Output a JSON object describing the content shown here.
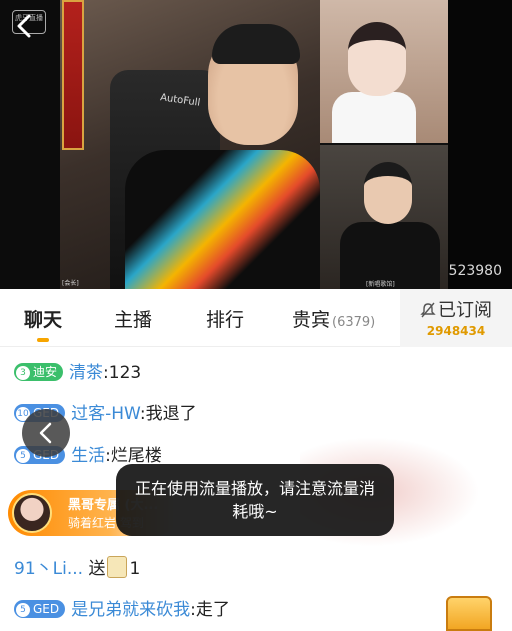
{
  "video": {
    "room_id": "523980",
    "watermark": "虎牙直播",
    "chair_logo": "AutoFull",
    "cam_labels": [
      "[会长]",
      "[新唱歌馆]"
    ]
  },
  "tabs": [
    {
      "label": "聊天",
      "active": true
    },
    {
      "label": "主播",
      "active": false
    },
    {
      "label": "排行",
      "active": false
    },
    {
      "label": "贵宾",
      "count": "(6379)",
      "active": false
    }
  ],
  "subscribe": {
    "label": "已订阅",
    "count": "2948434"
  },
  "chat": [
    {
      "level": "3",
      "badge": "迪安",
      "badge_color": "#3bbf6b",
      "user": "清茶",
      "sep": ":",
      "text": "123"
    },
    {
      "level": "10",
      "badge": "GED",
      "badge_color": "#4a90e2",
      "user": "过客-HW",
      "sep": ":",
      "text": "我退了"
    },
    {
      "level": "5",
      "badge": "GED",
      "badge_color": "#4a90e2",
      "user": "生活",
      "sep": ":",
      "text": "烂尾楼"
    },
    {
      "user": "91丶Li...",
      "text": "送",
      "gift_count": "1"
    },
    {
      "level": "5",
      "badge": "GED",
      "badge_color": "#4a90e2",
      "user": "是兄弟就来砍我",
      "sep": ":",
      "text": "走了"
    }
  ],
  "entry_banner": {
    "title": "黑哥专属  (大...",
    "subtitle": "骑着红岩  驾到"
  },
  "toast": "正在使用流量播放，请注意流量消耗哦~",
  "colors": {
    "accent": "#f7a500",
    "username": "#3b8ad6",
    "subscribe_count": "#e09a00"
  }
}
